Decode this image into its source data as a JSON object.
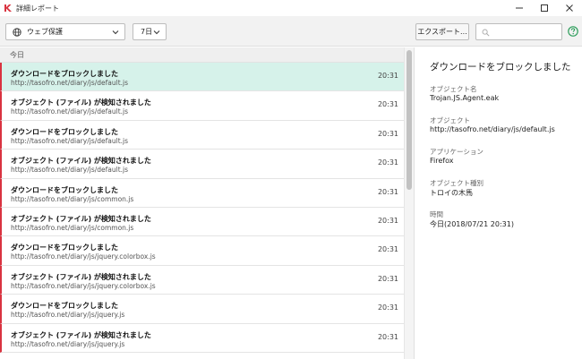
{
  "window": {
    "title": "詳細レポート"
  },
  "toolbar": {
    "category_label": "ウェブ保護",
    "period_label": "7日",
    "export_label": "エクスポート...",
    "search_placeholder": ""
  },
  "list": {
    "group_label": "今日",
    "items": [
      {
        "title": "ダウンロードをブロックしました",
        "url": "http://tasofro.net/diary/js/default.js",
        "time": "20:31",
        "selected": true
      },
      {
        "title": "オブジェクト (ファイル) が検知されました",
        "url": "http://tasofro.net/diary/js/default.js",
        "time": "20:31",
        "selected": false
      },
      {
        "title": "ダウンロードをブロックしました",
        "url": "http://tasofro.net/diary/js/default.js",
        "time": "20:31",
        "selected": false
      },
      {
        "title": "オブジェクト (ファイル) が検知されました",
        "url": "http://tasofro.net/diary/js/default.js",
        "time": "20:31",
        "selected": false
      },
      {
        "title": "ダウンロードをブロックしました",
        "url": "http://tasofro.net/diary/js/common.js",
        "time": "20:31",
        "selected": false
      },
      {
        "title": "オブジェクト (ファイル) が検知されました",
        "url": "http://tasofro.net/diary/js/common.js",
        "time": "20:31",
        "selected": false
      },
      {
        "title": "ダウンロードをブロックしました",
        "url": "http://tasofro.net/diary/js/jquery.colorbox.js",
        "time": "20:31",
        "selected": false
      },
      {
        "title": "オブジェクト (ファイル) が検知されました",
        "url": "http://tasofro.net/diary/js/jquery.colorbox.js",
        "time": "20:31",
        "selected": false
      },
      {
        "title": "ダウンロードをブロックしました",
        "url": "http://tasofro.net/diary/js/jquery.js",
        "time": "20:31",
        "selected": false
      },
      {
        "title": "オブジェクト (ファイル) が検知されました",
        "url": "http://tasofro.net/diary/js/jquery.js",
        "time": "20:31",
        "selected": false
      }
    ]
  },
  "detail": {
    "title": "ダウンロードをブロックしました",
    "fields": [
      {
        "label": "オブジェクト名",
        "value": "Trojan.JS.Agent.eak"
      },
      {
        "label": "オブジェクト",
        "value": "http://tasofro.net/diary/js/default.js"
      },
      {
        "label": "アプリケーション",
        "value": "Firefox"
      },
      {
        "label": "オブジェクト種別",
        "value": "トロイの木馬"
      },
      {
        "label": "時間",
        "value": "今日(2018/07/21 20:31)"
      }
    ]
  },
  "colors": {
    "accent_red": "#d93340",
    "selected_row": "#d6f2ea",
    "help_green": "#2e9e5c"
  },
  "icons": {
    "app": "kaspersky-logo-icon",
    "category": "globe-icon",
    "search": "search-icon",
    "help": "help-icon"
  }
}
